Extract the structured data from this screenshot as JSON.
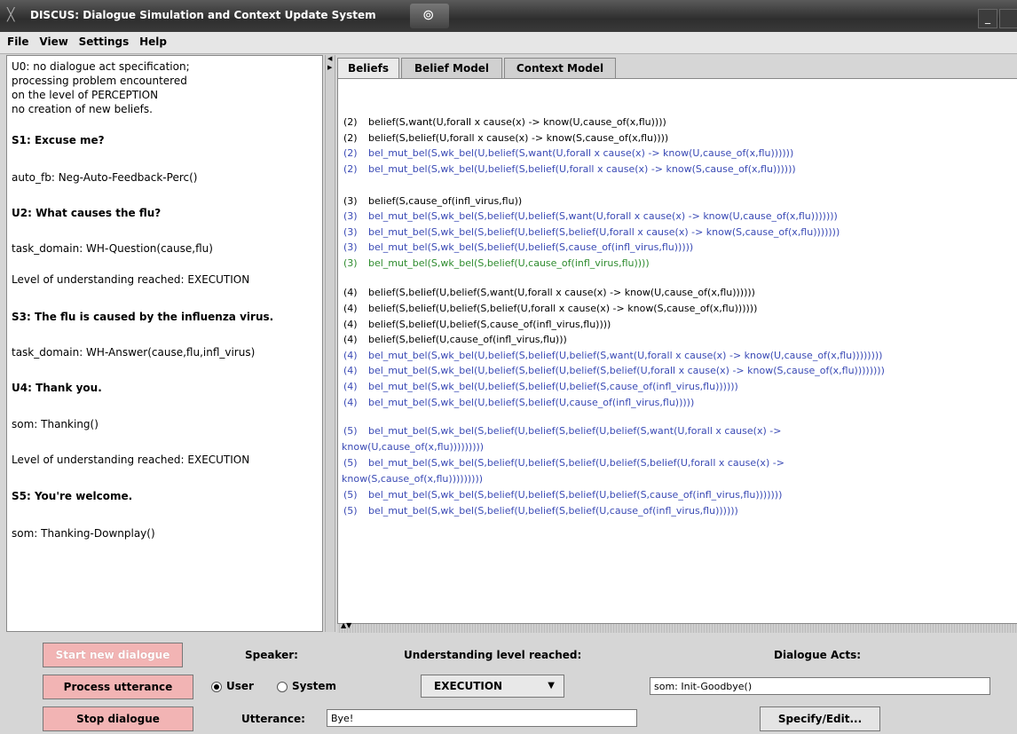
{
  "window": {
    "title": "DISCUS: Dialogue Simulation and Context Update System",
    "close_glyph": "╳",
    "tab_icon": "network-icon"
  },
  "menu": [
    "File",
    "View",
    "Settings",
    "Help"
  ],
  "dialogue_log": [
    {
      "text": "U0: no dialogue act specification;",
      "bold": false
    },
    {
      "text": "processing problem encountered",
      "bold": false
    },
    {
      "text": "on the level of PERCEPTION",
      "bold": false
    },
    {
      "text": "no creation of new beliefs.",
      "bold": false
    },
    {
      "text": "S1: Excuse me?",
      "bold": true
    },
    {
      "text": "auto_fb: Neg-Auto-Feedback-Perc()",
      "bold": false
    },
    {
      "text": "U2: What causes the flu?",
      "bold": true
    },
    {
      "text": "task_domain: WH-Question(cause,flu)",
      "bold": false
    },
    {
      "text": "Level of understanding reached: EXECUTION",
      "bold": false
    },
    {
      "text": "S3: The flu is caused by the influenza virus.",
      "bold": true
    },
    {
      "text": "task_domain: WH-Answer(cause,flu,infl_virus)",
      "bold": false
    },
    {
      "text": "U4: Thank you.",
      "bold": true
    },
    {
      "text": "som: Thanking()",
      "bold": false
    },
    {
      "text": "Level of understanding reached: EXECUTION",
      "bold": false
    },
    {
      "text": "S5: You're welcome.",
      "bold": true
    },
    {
      "text": "som: Thanking-Downplay()",
      "bold": false
    }
  ],
  "tabs": [
    {
      "label": "Beliefs",
      "active": true
    },
    {
      "label": "Belief Model",
      "active": false
    },
    {
      "label": "Context Model",
      "active": false
    }
  ],
  "beliefs": [
    {
      "n": "(2)",
      "text": "belief(S,want(U,forall x cause(x) -> know(U,cause_of(x,flu))))",
      "color": "black"
    },
    {
      "n": "(2)",
      "text": "belief(S,belief(U,forall x cause(x) -> know(S,cause_of(x,flu))))",
      "color": "black"
    },
    {
      "n": "(2)",
      "text": "bel_mut_bel(S,wk_bel(U,belief(S,want(U,forall x cause(x) -> know(U,cause_of(x,flu))))))",
      "color": "blue"
    },
    {
      "n": "(2)",
      "text": "bel_mut_bel(S,wk_bel(U,belief(S,belief(U,forall x cause(x) -> know(S,cause_of(x,flu))))))",
      "color": "blue"
    },
    {
      "n": "(3)",
      "text": "belief(S,cause_of(infl_virus,flu))",
      "color": "black"
    },
    {
      "n": "(3)",
      "text": "bel_mut_bel(S,wk_bel(S,belief(U,belief(S,want(U,forall x cause(x) -> know(U,cause_of(x,flu)))))))",
      "color": "blue"
    },
    {
      "n": "(3)",
      "text": "bel_mut_bel(S,wk_bel(S,belief(U,belief(S,belief(U,forall x cause(x) -> know(S,cause_of(x,flu)))))))",
      "color": "blue"
    },
    {
      "n": "(3)",
      "text": "bel_mut_bel(S,wk_bel(S,belief(U,belief(S,cause_of(infl_virus,flu)))))",
      "color": "blue"
    },
    {
      "n": "(3)",
      "text": "bel_mut_bel(S,wk_bel(S,belief(U,cause_of(infl_virus,flu))))",
      "color": "green"
    },
    {
      "n": "(4)",
      "text": "belief(S,belief(U,belief(S,want(U,forall x cause(x) -> know(U,cause_of(x,flu))))))",
      "color": "black"
    },
    {
      "n": "(4)",
      "text": "belief(S,belief(U,belief(S,belief(U,forall x cause(x) -> know(S,cause_of(x,flu))))))",
      "color": "black"
    },
    {
      "n": "(4)",
      "text": "belief(S,belief(U,belief(S,cause_of(infl_virus,flu))))",
      "color": "black"
    },
    {
      "n": "(4)",
      "text": "belief(S,belief(U,cause_of(infl_virus,flu)))",
      "color": "black"
    },
    {
      "n": "(4)",
      "text": "bel_mut_bel(S,wk_bel(U,belief(S,belief(U,belief(S,want(U,forall x cause(x) -> know(U,cause_of(x,flu))))))))",
      "color": "blue"
    },
    {
      "n": "(4)",
      "text": "bel_mut_bel(S,wk_bel(U,belief(S,belief(U,belief(S,belief(U,forall x cause(x) -> know(S,cause_of(x,flu))))))))",
      "color": "blue"
    },
    {
      "n": "(4)",
      "text": "bel_mut_bel(S,wk_bel(U,belief(S,belief(U,belief(S,cause_of(infl_virus,flu))))))",
      "color": "blue"
    },
    {
      "n": "(4)",
      "text": "bel_mut_bel(S,wk_bel(U,belief(S,belief(U,cause_of(infl_virus,flu)))))",
      "color": "blue"
    },
    {
      "n": "(5)",
      "text": "bel_mut_bel(S,wk_bel(S,belief(U,belief(S,belief(U,belief(S,want(U,forall x cause(x) ->",
      "color": "blue"
    },
    {
      "n": "",
      "text": "know(U,cause_of(x,flu)))))))))",
      "color": "blue"
    },
    {
      "n": "(5)",
      "text": "bel_mut_bel(S,wk_bel(S,belief(U,belief(S,belief(U,belief(S,belief(U,forall x cause(x) ->",
      "color": "blue"
    },
    {
      "n": "",
      "text": "know(S,cause_of(x,flu)))))))))",
      "color": "blue"
    },
    {
      "n": "(5)",
      "text": "bel_mut_bel(S,wk_bel(S,belief(U,belief(S,belief(U,belief(S,cause_of(infl_virus,flu)))))))",
      "color": "blue"
    },
    {
      "n": "(5)",
      "text": "bel_mut_bel(S,wk_bel(S,belief(U,belief(S,belief(U,cause_of(infl_virus,flu))))))",
      "color": "blue"
    }
  ],
  "colors": {
    "black": "#000000",
    "blue": "#3a4ab5",
    "green": "#2e8b2e",
    "button_pink": "#f2b4b4"
  },
  "controls": {
    "start_new_dialogue": "Start new dialogue",
    "process_utterance": "Process utterance",
    "stop_dialogue": "Stop dialogue",
    "speaker_label": "Speaker:",
    "speaker_user": "User",
    "speaker_system": "System",
    "speaker_selected": "User",
    "understanding_label": "Understanding level reached:",
    "understanding_value": "EXECUTION",
    "dialogue_acts_label": "Dialogue Acts:",
    "dialogue_acts_value": "som: Init-Goodbye()",
    "utterance_label": "Utterance:",
    "utterance_value": "Bye!",
    "specify_edit": "Specify/Edit..."
  }
}
